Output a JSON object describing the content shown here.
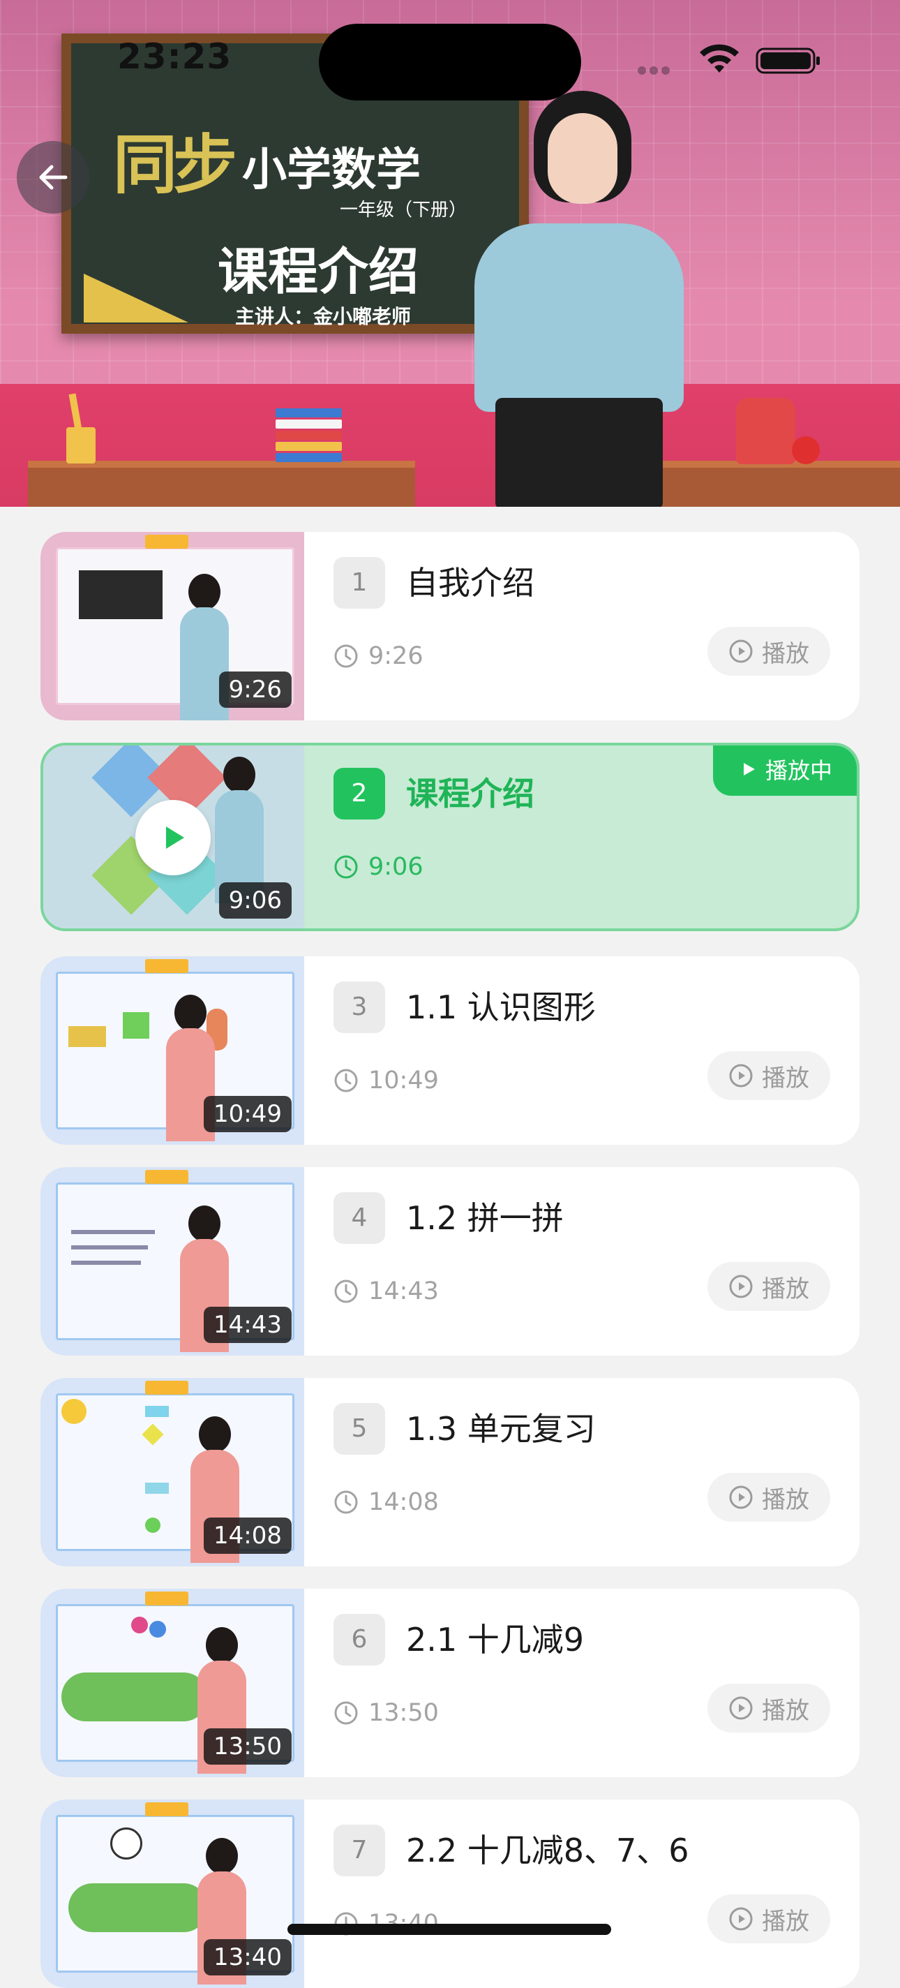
{
  "status_bar": {
    "time": "23:23"
  },
  "hero": {
    "board_big": "同步",
    "board_subject": "小学数学",
    "board_grade": "一年级（下册）",
    "board_course": "课程介绍",
    "board_teacher": "主讲人：金小嘟老师"
  },
  "list": {
    "play_label": "播放",
    "playing_label": "播放中",
    "active_index": 1,
    "items": [
      {
        "num": "1",
        "title": "自我介绍",
        "duration": "9:26"
      },
      {
        "num": "2",
        "title": "课程介绍",
        "duration": "9:06"
      },
      {
        "num": "3",
        "title": "1.1 认识图形",
        "duration": "10:49"
      },
      {
        "num": "4",
        "title": "1.2 拼一拼",
        "duration": "14:43"
      },
      {
        "num": "5",
        "title": "1.3 单元复习",
        "duration": "14:08"
      },
      {
        "num": "6",
        "title": "2.1 十几减9",
        "duration": "13:50"
      },
      {
        "num": "7",
        "title": "2.2 十几减8、7、6",
        "duration": "13:40"
      }
    ]
  },
  "colors": {
    "accent_green": "#22c35e",
    "active_bg": "#c7ebd4",
    "hero_pink": "#e58aae"
  },
  "icons": [
    "back-arrow-icon",
    "wifi-icon",
    "battery-icon",
    "clock-icon",
    "play-circle-icon",
    "play-triangle-icon"
  ]
}
